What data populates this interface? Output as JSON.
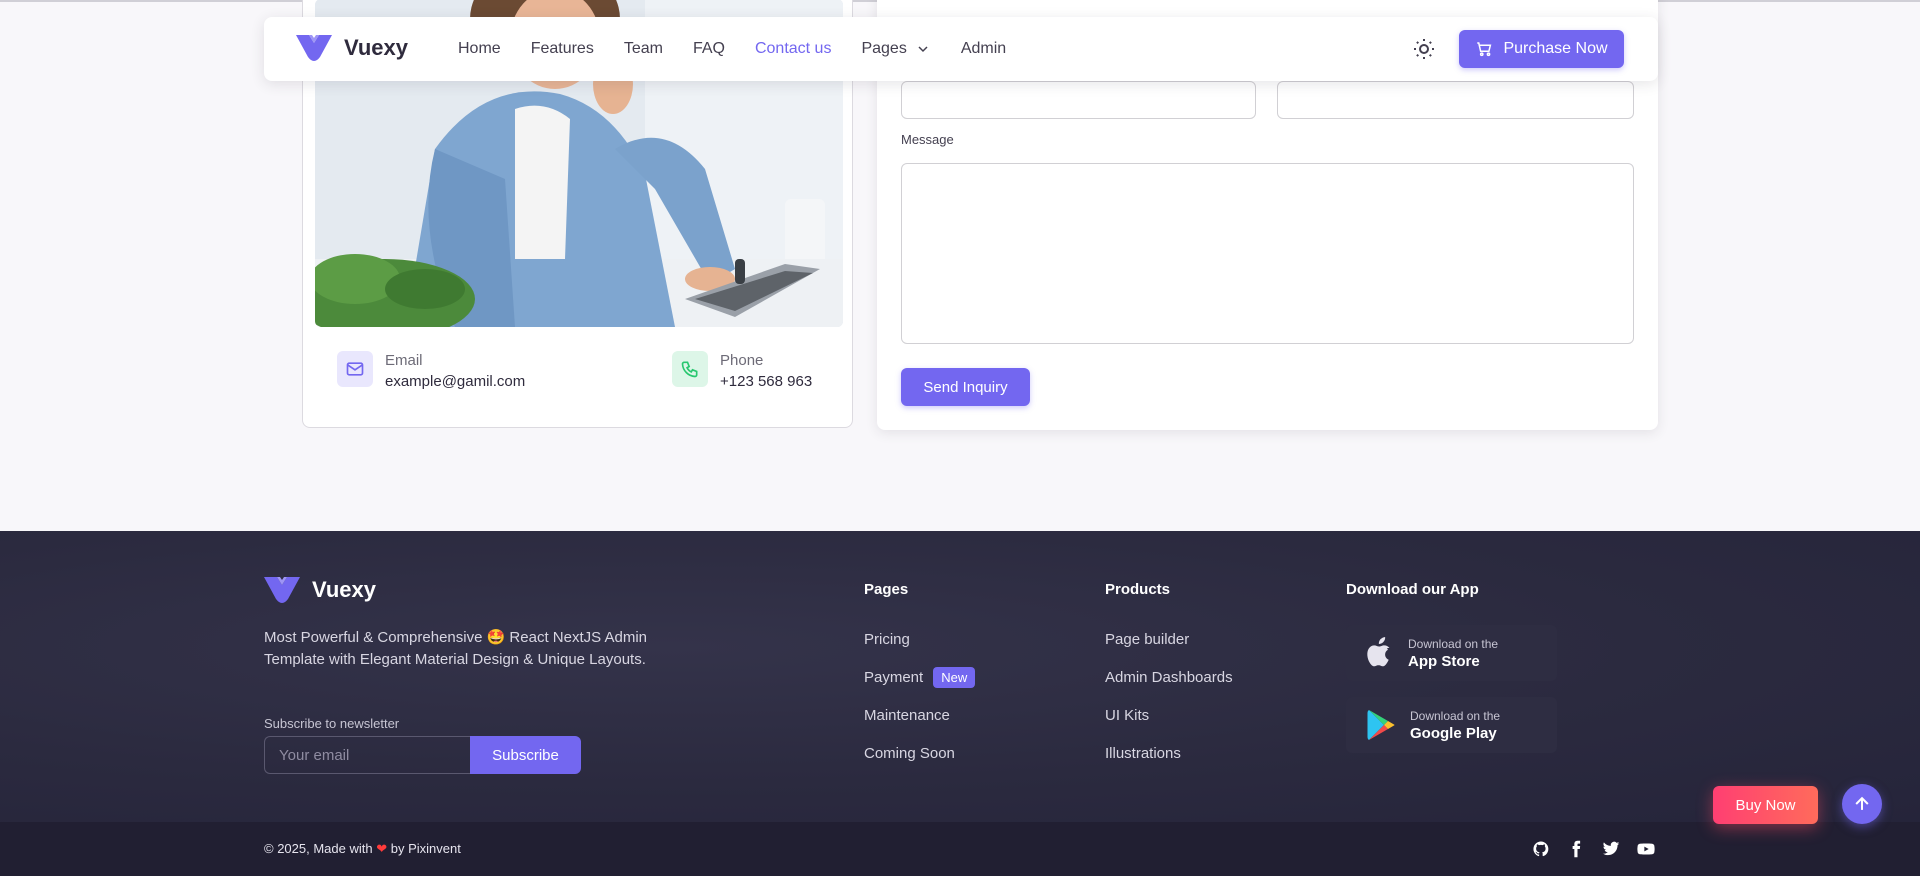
{
  "navbar": {
    "brand": "Vuexy",
    "links": [
      "Home",
      "Features",
      "Team",
      "FAQ",
      "Contact us",
      "Pages",
      "Admin"
    ],
    "active_link": "Contact us",
    "purchase_label": "Purchase Now",
    "icons": {
      "logo": "vuexy-logo-icon",
      "theme": "sun-icon",
      "cart": "cart-icon",
      "pages_chevron": "chevron-down-icon"
    }
  },
  "contact": {
    "email_label": "Email",
    "email_value": "example@gamil.com",
    "phone_label": "Phone",
    "phone_value": "+123 568 963"
  },
  "form": {
    "message_label": "Message",
    "send_label": "Send Inquiry"
  },
  "footer": {
    "brand": "Vuexy",
    "description": "Most Powerful & Comprehensive 🤩 React NextJS Admin Template with Elegant Material Design & Unique Layouts.",
    "newsletter_label": "Subscribe to newsletter",
    "email_placeholder": "Your email",
    "subscribe_label": "Subscribe",
    "pages": {
      "title": "Pages",
      "items": [
        "Pricing",
        "Payment",
        "Maintenance",
        "Coming Soon"
      ],
      "new_badge": "New"
    },
    "products": {
      "title": "Products",
      "items": [
        "Page builder",
        "Admin Dashboards",
        "UI Kits",
        "Illustrations"
      ]
    },
    "app": {
      "title": "Download our App",
      "appstore_small": "Download on the",
      "appstore_big": "App Store",
      "play_small": "Download on the",
      "play_big": "Google Play"
    },
    "copyright_prefix": "© 2025, Made with",
    "copyright_suffix": "by Pixinvent",
    "social_icons": [
      "github-icon",
      "facebook-icon",
      "twitter-icon",
      "youtube-icon"
    ]
  },
  "floating": {
    "buy_now": "Buy Now",
    "scroll_top_icon": "arrow-up-icon"
  },
  "colors": {
    "primary": "#7367f0",
    "footer_bg": "#2b2a3f",
    "bottom_bar": "#211f32",
    "buy_now": "#ff4c6a"
  }
}
